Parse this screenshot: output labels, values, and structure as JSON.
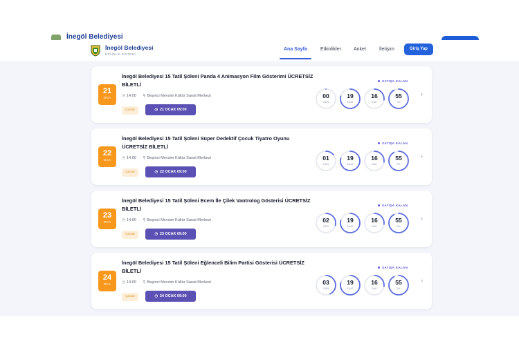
{
  "ghost_header": {
    "brand": "İnegöl Belediyesi"
  },
  "nav": {
    "brand_title": "İnegöl Belediyesi",
    "brand_subtitle": "ETKİNLİK SİSTEMİ",
    "links": [
      "Ana Sayfa",
      "Etkinlikler",
      "Anket",
      "İletişim"
    ],
    "active": "Ana Sayfa",
    "login": "Giriş Yap"
  },
  "colors": {
    "accent": "#3a5bd9",
    "badge": "#f7981d",
    "date_button": "#5b50b4",
    "timer_ring": "#5b6ee0"
  },
  "countdown_label": "SATIŞA KALAN",
  "unit_labels": [
    "GÜN",
    "SAAT",
    "DAK",
    "SN"
  ],
  "events": [
    {
      "day": "21",
      "month": "OCA",
      "title": "İnegöl Belediyesi 15 Tatil Şöleni Panda 4 Animasyon Film Gösterimi ÜCRETSİZ BİLETLİ",
      "time": "14:00",
      "venue": "Beşinci Mevsim Kültür Sanat Merkezi",
      "tag": "Çocuk",
      "sale_date": "21 OCAK 09:00",
      "countdown": [
        {
          "value": "00",
          "fraction": 0.0
        },
        {
          "value": "19",
          "fraction": 0.79
        },
        {
          "value": "16",
          "fraction": 0.27
        },
        {
          "value": "55",
          "fraction": 0.92
        }
      ]
    },
    {
      "day": "22",
      "month": "OCA",
      "title": "İnegöl Belediyesi 15 Tatil Şöleni Süper Dedektif Çocuk Tiyatro Oyunu ÜCRETSİZ BİLETLİ",
      "time": "14:00",
      "venue": "Beşinci Mevsim Kültür Sanat Merkezi",
      "tag": "Çocuk",
      "sale_date": "22 OCAK 09:00",
      "countdown": [
        {
          "value": "01",
          "fraction": 0.14
        },
        {
          "value": "19",
          "fraction": 0.79
        },
        {
          "value": "16",
          "fraction": 0.27
        },
        {
          "value": "55",
          "fraction": 0.92
        }
      ]
    },
    {
      "day": "23",
      "month": "OCA",
      "title": "İnegöl Belediyesi 15 Tatil Şöleni Ecem İle Çilek Vantrolog Gösterisi ÜCRETSİZ BİLETLİ",
      "time": "14:00",
      "venue": "Beşinci Mevsim Kültür Sanat Merkezi",
      "tag": "Çocuk",
      "sale_date": "23 OCAK 09:00",
      "countdown": [
        {
          "value": "02",
          "fraction": 0.29
        },
        {
          "value": "19",
          "fraction": 0.79
        },
        {
          "value": "16",
          "fraction": 0.27
        },
        {
          "value": "55",
          "fraction": 0.92
        }
      ]
    },
    {
      "day": "24",
      "month": "OCA",
      "title": "İnegöl Belediyesi 15 Tatil Şöleni Eğlenceli Bilim Partisi Gösterisi ÜCRETSİZ BİLETLİ",
      "time": "14:00",
      "venue": "Beşinci Mevsim Kültür Sanat Merkezi",
      "tag": "Çocuk",
      "sale_date": "24 OCAK 09:00",
      "countdown": [
        {
          "value": "03",
          "fraction": 0.43
        },
        {
          "value": "19",
          "fraction": 0.79
        },
        {
          "value": "16",
          "fraction": 0.27
        },
        {
          "value": "55",
          "fraction": 0.92
        }
      ]
    }
  ]
}
